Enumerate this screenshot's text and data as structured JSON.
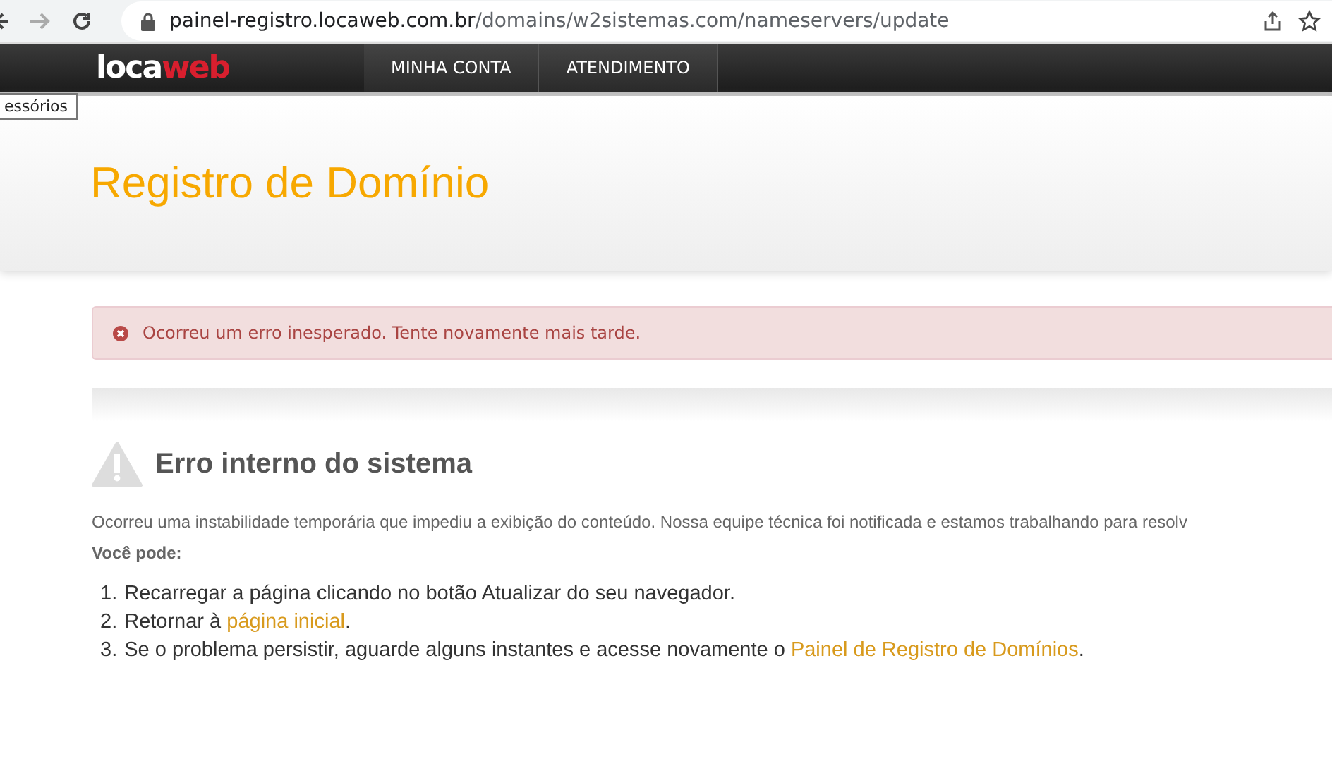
{
  "browser": {
    "url_host": "painel-registro.locaweb.com.br",
    "url_path": "/domains/w2sistemas.com/nameservers/update"
  },
  "nav": {
    "logo": [
      {
        "text": "loca",
        "kind": "plain"
      },
      {
        "text": "web",
        "kind": "accent"
      }
    ],
    "items": [
      {
        "label": "MINHA CONTA"
      },
      {
        "label": "ATENDIMENTO"
      }
    ]
  },
  "tooltip": "essórios",
  "page_title": "Registro de Domínio",
  "alert": "Ocorreu um erro inesperado. Tente novamente mais tarde.",
  "error": {
    "title": "Erro interno do sistema",
    "description": "Ocorreu uma instabilidade temporária que impediu a exibição do conteúdo. Nossa equipe técnica foi notificada e estamos trabalhando para resolv",
    "lead": "Você pode:",
    "steps": [
      {
        "number": "1.",
        "text": "Recarregar a página clicando no botão Atualizar do seu navegador."
      },
      {
        "number": "2.",
        "text": "Retornar à ",
        "link": "página inicial",
        "after": "."
      },
      {
        "number": "3.",
        "text": "Se o problema persistir, aguarde alguns instantes e acesse novamente o ",
        "link": "Painel de Registro de Domínios",
        "after": "."
      }
    ]
  }
}
